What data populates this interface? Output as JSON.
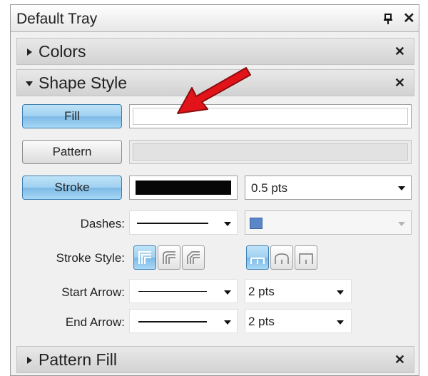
{
  "tray": {
    "title": "Default Tray",
    "close_glyph": "✕"
  },
  "sections": {
    "colors": {
      "title": "Colors",
      "expanded": false,
      "close_glyph": "✕"
    },
    "shape_style": {
      "title": "Shape Style",
      "expanded": true,
      "close_glyph": "✕"
    },
    "pattern_fill": {
      "title": "Pattern Fill",
      "expanded": false,
      "close_glyph": "✕"
    }
  },
  "shape_style": {
    "fill_button": "Fill",
    "pattern_button": "Pattern",
    "stroke_button": "Stroke",
    "stroke_color": "#060606",
    "stroke_width": "0.5 pts",
    "dashes_label": "Dashes:",
    "dash_color": "#5b87c8",
    "stroke_style_label": "Stroke Style:",
    "start_arrow_label": "Start Arrow:",
    "start_arrow_size": "2 pts",
    "end_arrow_label": "End Arrow:",
    "end_arrow_size": "2 pts",
    "join_styles": [
      "miter-join-icon",
      "round-join-icon",
      "bevel-join-icon"
    ],
    "cap_styles": [
      "flat-cap-icon",
      "round-cap-icon",
      "square-cap-icon"
    ]
  },
  "colors": {
    "active_button": "#9fd0f0",
    "annotation_arrow": "#e2141a"
  }
}
